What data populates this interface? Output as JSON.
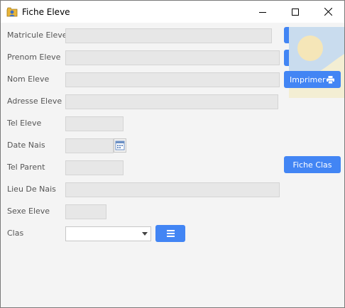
{
  "window": {
    "title": "Fiche Eleve",
    "app_icon": "folder-person-icon",
    "controls": {
      "minimize": "minimize-icon",
      "maximize": "maximize-icon",
      "close": "close-icon"
    }
  },
  "form": {
    "fields": [
      {
        "label": "Matricule Eleve",
        "value": ""
      },
      {
        "label": "Prenom Eleve",
        "value": ""
      },
      {
        "label": "Nom Eleve",
        "value": ""
      },
      {
        "label": "Adresse Eleve",
        "value": ""
      },
      {
        "label": "Tel Eleve",
        "value": ""
      },
      {
        "label": "Date Nais",
        "value": ""
      },
      {
        "label": "Tel Parent",
        "value": ""
      },
      {
        "label": "Lieu De Nais",
        "value": ""
      },
      {
        "label": "Sexe Eleve",
        "value": ""
      },
      {
        "label": "Clas",
        "value": ""
      }
    ],
    "date_picker_icon": "calendar-icon",
    "clas_menu_icon": "menu-list-icon"
  },
  "buttons": {
    "imprimer": {
      "label": "Imprimer",
      "icon": "printer-icon"
    },
    "fiche_clas": {
      "label": "Fiche Clas"
    }
  },
  "photo": {
    "icon": "image-placeholder-icon"
  },
  "colors": {
    "accent": "#4285f4",
    "field_bg": "#e7e7e7",
    "window_bg": "#f4f4f4"
  }
}
